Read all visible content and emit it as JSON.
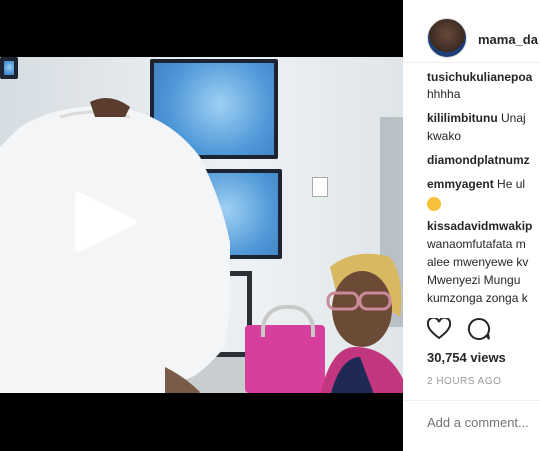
{
  "post": {
    "username": "mama_da",
    "views": "30,754 views",
    "time_ago": "2 HOURS AGO",
    "comment_placeholder": "Add a comment..."
  },
  "comments": [
    {
      "user": "tusichukulianepoa",
      "text": ""
    },
    {
      "user": "",
      "text": "hhhha"
    },
    {
      "user": "kililimbitunu",
      "text": "Unaj"
    },
    {
      "user": "",
      "text": "kwako"
    },
    {
      "user": "diamondplatnumz",
      "text": ""
    },
    {
      "user": "emmyagent",
      "text": "He ul"
    },
    {
      "user": "",
      "text": "",
      "emoji": "grinning-face-icon"
    },
    {
      "user": "kissadavidmwakip",
      "text": ""
    },
    {
      "user": "",
      "text": "wanaomfutafata m"
    },
    {
      "user": "",
      "text": "alee mwenyewe kv"
    },
    {
      "user": "",
      "text": "Mwenyezi Mungu"
    },
    {
      "user": "",
      "text": "kumzonga zonga k"
    }
  ],
  "icons": {
    "play": "play-icon",
    "like": "heart-icon",
    "comment": "comment-icon"
  },
  "colors": {
    "text": "#262626",
    "muted": "#999999",
    "border": "#efefef"
  }
}
